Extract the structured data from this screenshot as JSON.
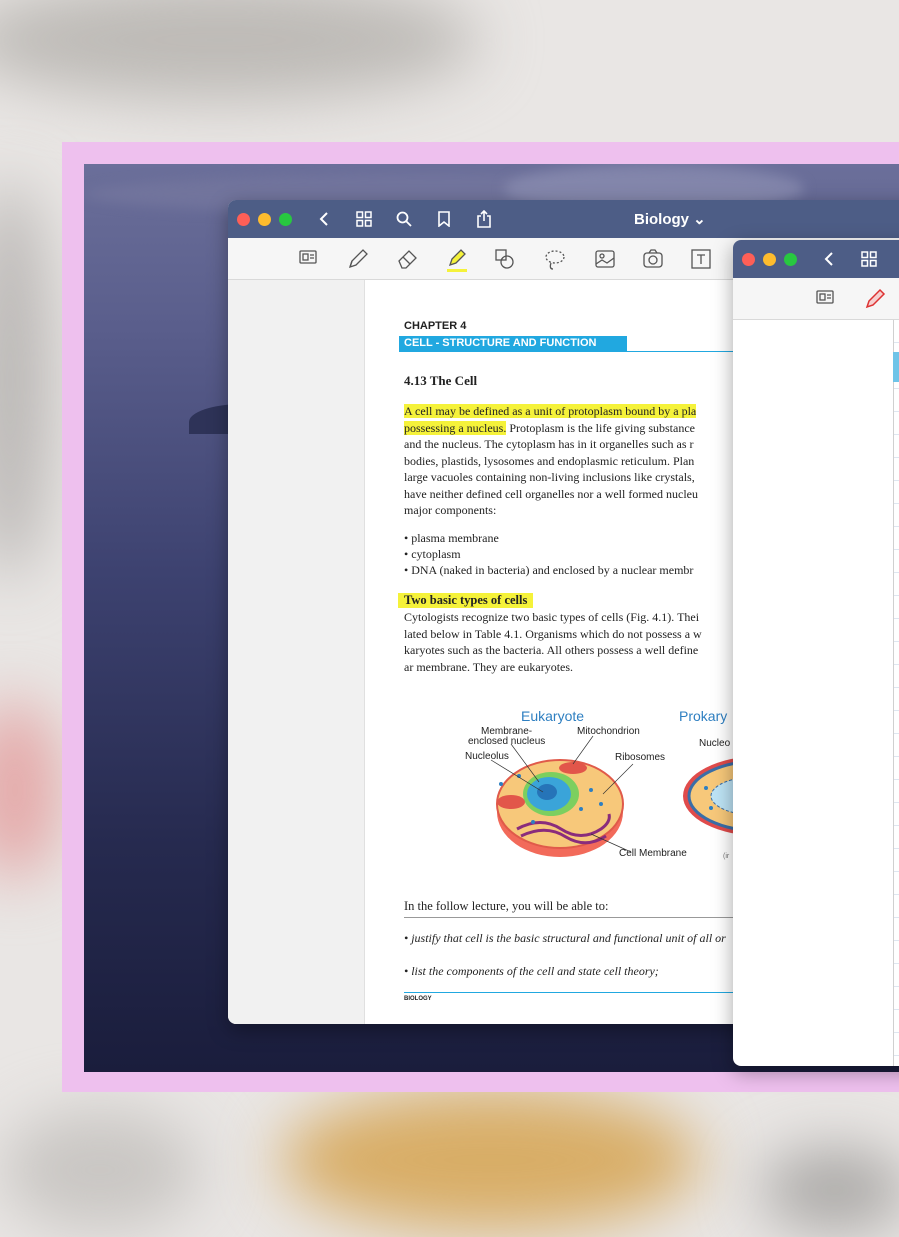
{
  "main_window": {
    "title": "Biology ⌄",
    "toolbar_icons": [
      "back-icon",
      "grid-icon",
      "search-icon",
      "bookmark-icon",
      "share-icon"
    ],
    "tools": [
      "page-layout-icon",
      "pen-icon",
      "eraser-icon",
      "highlighter-icon",
      "shapes-icon",
      "lasso-icon",
      "image-icon",
      "camera-icon",
      "text-icon"
    ]
  },
  "page": {
    "chapter": "CHAPTER 4",
    "chapter_subtitle": "CELL - STRUCTURE AND FUNCTION",
    "section_title": "4.13  The Cell",
    "paragraph_lines": [
      {
        "hl": "A cell may be defined as a unit of protoplasm bound by a pla",
        "rest": ""
      },
      {
        "hl": "possessing a nucleus.",
        "rest": " Protoplasm is the life giving substance"
      },
      {
        "hl": "",
        "rest": "and the nucleus. The cytoplasm has in it organelles such as r"
      },
      {
        "hl": "",
        "rest": "bodies, plastids, lysosomes and endoplasmic reticulum. Plan"
      },
      {
        "hl": "",
        "rest": "large vacuoles containing non-living inclusions like crystals, "
      },
      {
        "hl": "",
        "rest": "have neither defined cell organelles nor a well formed nucleu"
      },
      {
        "hl": "",
        "rest": "major components:"
      }
    ],
    "bullets": [
      "• plasma membrane",
      "• cytoplasm",
      "• DNA (naked in bacteria) and enclosed by a nuclear membr"
    ],
    "subheading": "Two basic types of cells",
    "paragraph2_lines": [
      "Cytologists recognize two basic types of cells (Fig. 4.1). Thei",
      "lated below in Table 4.1. Organisms which do not possess a w",
      "karyotes such as the bacteria. All others possess a well define",
      "ar membrane. They are eukaryotes."
    ],
    "figure": {
      "eukaryote": "Eukaryote",
      "prokaryote": "Prokary",
      "membrane_label": "Membrane-",
      "membrane_label2": "enclosed nucleus",
      "mitochondrion": "Mitochondrion",
      "nucleolus": "Nucleolus",
      "ribosomes": "Ribosomes",
      "nucleoid": "Nucleo",
      "cell_membrane": "Cell Membrane",
      "partial": "(ir"
    },
    "lecture_intro": "In the follow lecture, you will be able to:",
    "goals": [
      "• justify that cell is the basic structural and functional unit of all or",
      "• list the components of the cell and state cell theory;"
    ],
    "footer": "BIOLOGY"
  },
  "second_window": {
    "toolbar_icons": [
      "back-icon",
      "grid-icon"
    ],
    "tools": [
      "page-layout-icon",
      "pen-icon"
    ]
  },
  "colors": {
    "frame": "#eec0ee",
    "titlebar": "#4d5d86",
    "highlight": "#f5f23a",
    "accent": "#21a8e0"
  }
}
